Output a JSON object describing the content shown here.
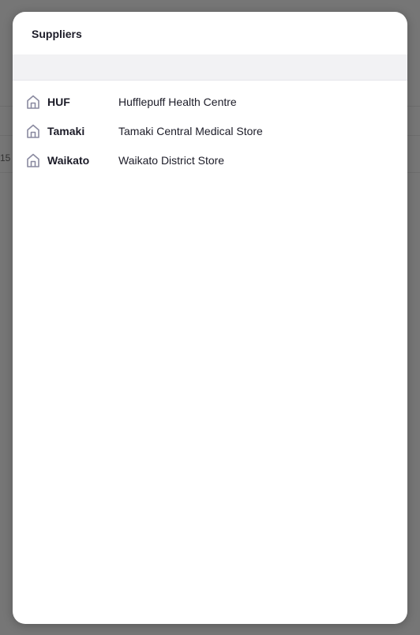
{
  "background": {
    "rows": [
      "",
      "",
      "15"
    ]
  },
  "modal": {
    "title": "Suppliers",
    "search": {
      "placeholder": "",
      "value": ""
    },
    "items": [
      {
        "icon": "home-icon",
        "code": "HUF",
        "name": "Hufflepuff Health Centre"
      },
      {
        "icon": "home-icon",
        "code": "Tamaki",
        "name": "Tamaki Central Medical Store"
      },
      {
        "icon": "home-icon",
        "code": "Waikato",
        "name": "Waikato District Store"
      }
    ]
  },
  "colors": {
    "overlay": "#6e6e6e",
    "modal_bg": "#ffffff",
    "search_bg": "#f2f2f4",
    "text": "#1c1c28",
    "icon": "#8a8aa0"
  }
}
